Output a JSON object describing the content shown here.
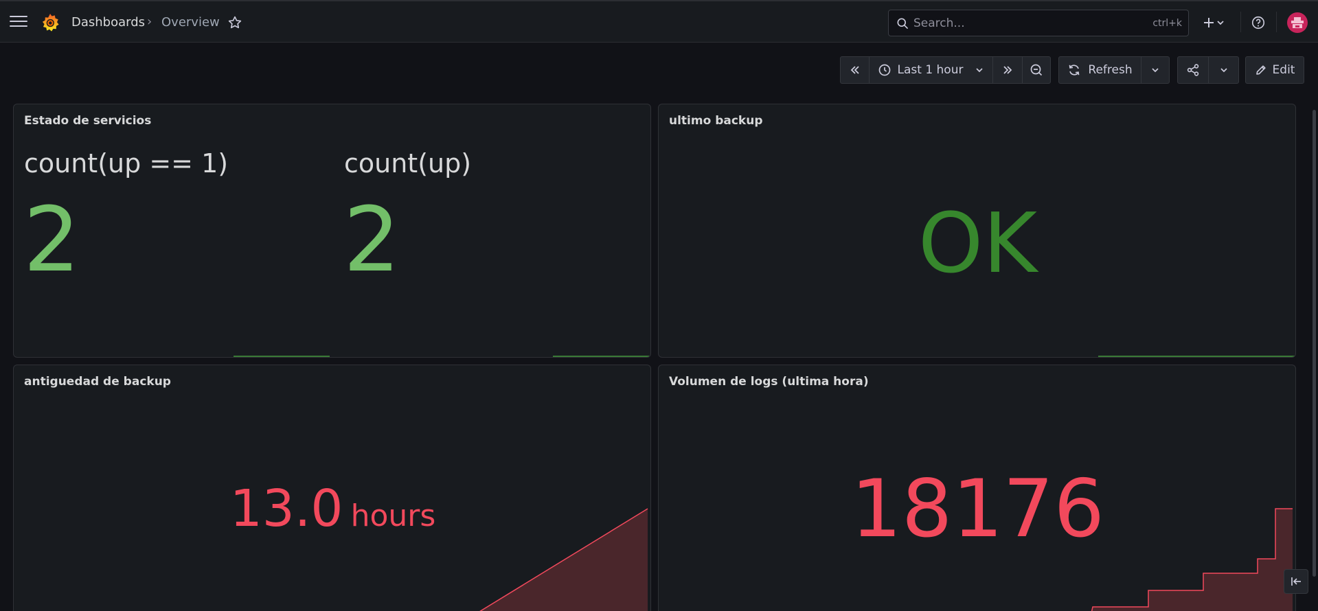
{
  "nav": {
    "breadcrumb_root": "Dashboards",
    "breadcrumb_separator": "›",
    "breadcrumb_current": "Overview"
  },
  "search": {
    "placeholder": "Search...",
    "shortcut": "ctrl+k"
  },
  "toolbar": {
    "time_range": "Last 1 hour",
    "refresh_label": "Refresh",
    "edit_label": "Edit"
  },
  "panels": [
    {
      "title": "Estado de servicios",
      "stats": [
        {
          "label": "count(up == 1)",
          "value": "2"
        },
        {
          "label": "count(up)",
          "value": "2"
        }
      ]
    },
    {
      "title": "ultimo backup",
      "value": "OK"
    },
    {
      "title": "antiguedad de backup",
      "value": "13.0",
      "unit": "hours"
    },
    {
      "title": "Volumen de logs (ultima hora)",
      "value": "18176"
    }
  ],
  "colors": {
    "background": "#111217",
    "panel": "#181b1f",
    "ok_green": "#73bf69",
    "ok_dark_green": "#37872d",
    "alert_red": "#f2495c",
    "brand_orange": "#f46800"
  }
}
